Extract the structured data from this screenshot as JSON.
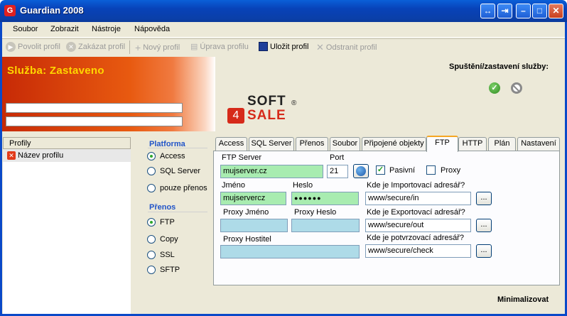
{
  "window": {
    "title": "Guardian 2008"
  },
  "menu": [
    "Soubor",
    "Zobrazit",
    "Nástroje",
    "Nápověda"
  ],
  "toolbar": {
    "enable_profile": "Povolit profil",
    "disable_profile": "Zakázat profil",
    "new_profile": "Nový profil",
    "edit_profile": "Úprava profilu",
    "save_profile": "Uložit profil",
    "remove_profile": "Odstranit profil"
  },
  "banner": {
    "service_status": "Služba:  Zastaveno",
    "service_control_label": "Spuštění/zastavení služby:",
    "logo_top": "SOFT",
    "logo_bottom": "SALE",
    "logo_reg": "®"
  },
  "profiles": {
    "header": "Profily",
    "items": [
      "Název profilu"
    ]
  },
  "platform": {
    "title": "Platforma",
    "options": [
      "Access",
      "SQL Server",
      "pouze přenos"
    ],
    "selected": "Access"
  },
  "transfer": {
    "title": "Přenos",
    "options": [
      "FTP",
      "Copy",
      "SSL",
      "SFTP"
    ],
    "selected": "FTP"
  },
  "tabs": [
    "Access",
    "SQL Server",
    "Přenos",
    "Soubor",
    "Připojené objekty",
    "FTP",
    "HTTP",
    "Plán",
    "Nastavení"
  ],
  "selected_tab": "FTP",
  "ftp": {
    "server_label": "FTP Server",
    "server_value": "mujserver.cz",
    "port_label": "Port",
    "port_value": "21",
    "passive_label": "Pasivní",
    "passive_checked": true,
    "proxy_label": "Proxy",
    "proxy_checked": false,
    "user_label": "Jméno",
    "user_value": "mujservercz",
    "password_label": "Heslo",
    "password_value": "●●●●●●",
    "proxy_user_label": "Proxy Jméno",
    "proxy_user_value": "",
    "proxy_password_label": "Proxy Heslo",
    "proxy_password_value": "",
    "proxy_host_label": "Proxy Hostitel",
    "proxy_host_value": "",
    "import_label": "Kde je Importovací adresář?",
    "import_value": "www/secure/in",
    "export_label": "Kde je Exportovací adresář?",
    "export_value": "www/secure/out",
    "confirm_label": "Kde je potvrzovací adresář?",
    "confirm_value": "www/secure/check",
    "browse_label": "..."
  },
  "footer": {
    "minimize": "Minimalizovat"
  }
}
